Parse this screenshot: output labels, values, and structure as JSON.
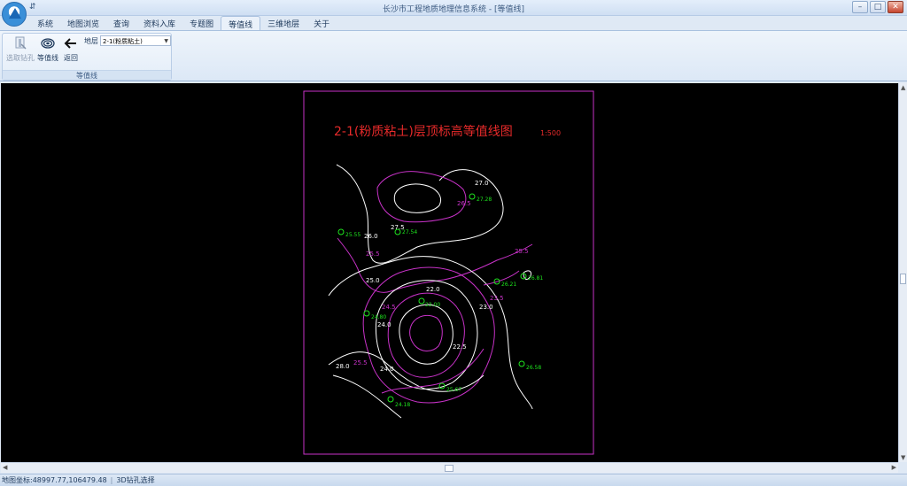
{
  "app": {
    "window_title": "长沙市工程地质地理信息系统 - [等值线]",
    "qat_symbol": "⇵"
  },
  "tabs": [
    {
      "label": "系统"
    },
    {
      "label": "地图浏览"
    },
    {
      "label": "查询"
    },
    {
      "label": "资料入库"
    },
    {
      "label": "专题图"
    },
    {
      "label": "等值线"
    },
    {
      "label": "三维地层"
    },
    {
      "label": "关于"
    }
  ],
  "ribbon": {
    "buttons": [
      {
        "label": "选取钻孔",
        "icon": "borehole-select-icon"
      },
      {
        "label": "等值线",
        "icon": "contour-icon"
      },
      {
        "label": "返回",
        "icon": "arrow-left-icon"
      }
    ],
    "layer_label": "地层",
    "layer_value": "2-1(粉质粘土)",
    "group_label": "等值线"
  },
  "map": {
    "title": "2-1(粉质粘土)层顶标高等值线图",
    "scale": "1:500",
    "contour_labels": [
      "27.0",
      "26.5",
      "26.0",
      "25.5",
      "25.0",
      "24.5",
      "24.0",
      "23.5",
      "23.0",
      "22.5",
      "22.0",
      "27.5",
      "28.0"
    ],
    "boreholes": [
      "27.28",
      "25.55",
      "27.54",
      "26.81",
      "26.21",
      "22.00",
      "24.80",
      "25.67",
      "26.58",
      "24.18"
    ],
    "colors": {
      "white": "#ffffff",
      "magenta": "#c832c8",
      "green": "#1ee61e",
      "red": "#e62a2a"
    }
  },
  "status": {
    "coord_label": "地图坐标:48997.77,106479.48",
    "mode": "3D钻孔选择"
  }
}
